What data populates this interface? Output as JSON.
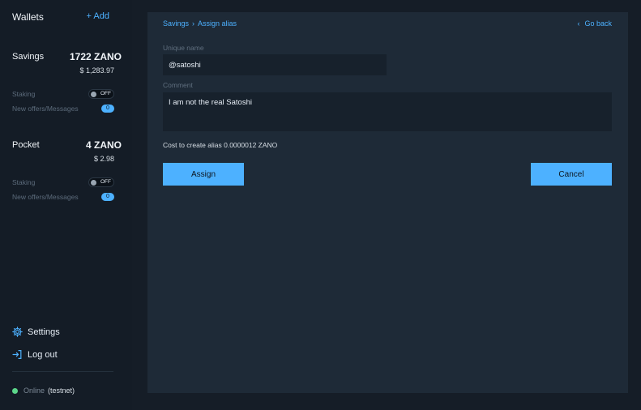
{
  "sidebar": {
    "title": "Wallets",
    "add_label": "+ Add",
    "wallets": [
      {
        "name": "Savings",
        "balance": "1722 ZANO",
        "usd": "$ 1,283.97",
        "staking_label": "Staking",
        "staking_state": "OFF",
        "messages_label": "New offers/Messages",
        "messages_count": "0"
      },
      {
        "name": "Pocket",
        "balance": "4 ZANO",
        "usd": "$ 2.98",
        "staking_label": "Staking",
        "staking_state": "OFF",
        "messages_label": "New offers/Messages",
        "messages_count": "0"
      }
    ],
    "menu": {
      "settings_label": "Settings",
      "logout_label": "Log out"
    },
    "status": {
      "online": "Online",
      "network": "(testnet)"
    }
  },
  "main": {
    "breadcrumb": [
      "Savings",
      "Assign alias"
    ],
    "go_back_label": "Go back",
    "unique_name_label": "Unique name",
    "unique_name_value": "@satoshi",
    "comment_label": "Comment",
    "comment_value": "I am not the real Satoshi",
    "cost_text": "Cost to create alias 0.0000012 ZANO",
    "assign_label": "Assign",
    "cancel_label": "Cancel"
  },
  "colors": {
    "accent": "#4db1ff",
    "sidebar_bg": "#141c26",
    "panel_bg": "#1e2a37",
    "input_bg": "#17212c",
    "online_dot": "#5cd68a"
  },
  "icons": {
    "settings": "gear-icon",
    "logout": "logout-icon",
    "go_back": "chevron-left-icon",
    "breadcrumb_separator": "chevron-right-icon"
  }
}
